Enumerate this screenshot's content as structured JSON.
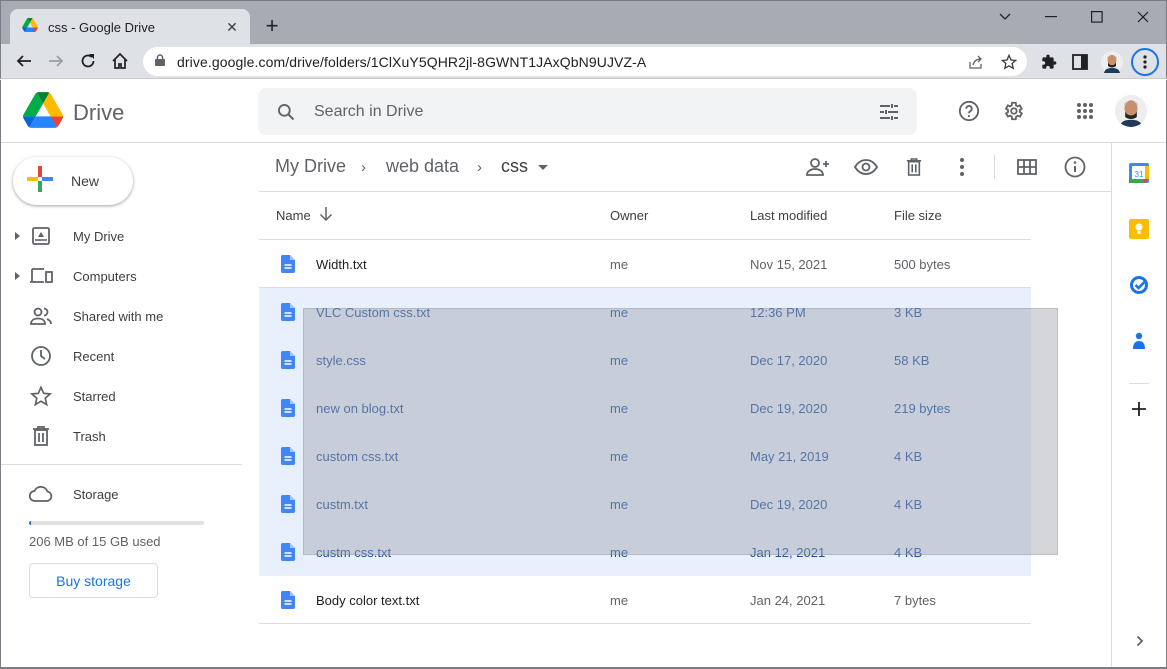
{
  "browser": {
    "tab_title": "css - Google Drive",
    "url": "drive.google.com/drive/folders/1ClXuY5QHR2jl-8GWNT1JAxQbN9UJVZ-A",
    "icons": {
      "back": "arrow-left-icon",
      "forward": "arrow-right-icon",
      "reload": "reload-icon",
      "home": "home-icon",
      "lock": "lock-icon",
      "share": "share-icon",
      "bookmark": "star-icon",
      "extensions": "puzzle-icon",
      "sidepanel": "side-panel-icon",
      "menu": "more-vert-icon"
    }
  },
  "header": {
    "app_name": "Drive",
    "search_placeholder": "Search in Drive",
    "icons": [
      "search-icon",
      "tune-icon",
      "help-icon",
      "settings-icon",
      "apps-grid-icon",
      "avatar"
    ]
  },
  "sidebar": {
    "new_label": "New",
    "items": [
      {
        "label": "My Drive",
        "icon": "my-drive-icon",
        "expandable": true
      },
      {
        "label": "Computers",
        "icon": "computers-icon",
        "expandable": true
      },
      {
        "label": "Shared with me",
        "icon": "shared-icon",
        "expandable": false
      },
      {
        "label": "Recent",
        "icon": "clock-icon",
        "expandable": false
      },
      {
        "label": "Starred",
        "icon": "star-icon",
        "expandable": false
      },
      {
        "label": "Trash",
        "icon": "trash-icon",
        "expandable": false
      }
    ],
    "storage": {
      "label": "Storage",
      "used_text": "206 MB of 15 GB used",
      "used_fraction": 0.013,
      "buy_label": "Buy storage"
    }
  },
  "breadcrumb": {
    "items": [
      "My Drive",
      "web data",
      "css"
    ]
  },
  "actions": [
    "share-icon",
    "preview-icon",
    "trash-icon",
    "more-vert-icon",
    "grid-view-icon",
    "info-icon"
  ],
  "table": {
    "columns": {
      "name": "Name",
      "owner": "Owner",
      "modified": "Last modified",
      "size": "File size"
    },
    "sort": "name-ascending",
    "rows": [
      {
        "name": "Width.txt",
        "owner": "me",
        "modified": "Nov 15, 2021",
        "size": "500 bytes",
        "selected": false
      },
      {
        "name": "VLC Custom css.txt",
        "owner": "me",
        "modified": "12:36 PM",
        "size": "3 KB",
        "selected": true
      },
      {
        "name": "style.css",
        "owner": "me",
        "modified": "Dec 17, 2020",
        "size": "58 KB",
        "selected": true
      },
      {
        "name": "new on blog.txt",
        "owner": "me",
        "modified": "Dec 19, 2020",
        "size": "219 bytes",
        "selected": true
      },
      {
        "name": "custom css.txt",
        "owner": "me",
        "modified": "May 21, 2019",
        "size": "4 KB",
        "selected": true
      },
      {
        "name": "custm.txt",
        "owner": "me",
        "modified": "Dec 19, 2020",
        "size": "4 KB",
        "selected": true
      },
      {
        "name": "custm css.txt",
        "owner": "me",
        "modified": "Jan 12, 2021",
        "size": "4 KB",
        "selected": true
      },
      {
        "name": "Body color text.txt",
        "owner": "me",
        "modified": "Jan 24, 2021",
        "size": "7 bytes",
        "selected": false
      }
    ]
  },
  "right_rail": {
    "items": [
      "calendar-icon",
      "keep-icon",
      "tasks-icon",
      "contacts-icon",
      "add-icon"
    ],
    "calendar_day": "31"
  },
  "colors": {
    "accent": "#1a73e8",
    "selected_row": "#e8f0fe",
    "selected_text": "#174ea6",
    "file_icon": "#4285f4"
  }
}
